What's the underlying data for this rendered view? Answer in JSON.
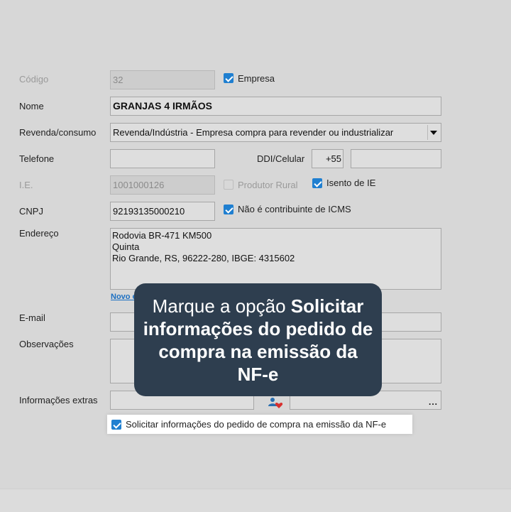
{
  "form": {
    "codigo": {
      "label": "Código",
      "value": "32"
    },
    "empresa": {
      "label": "Empresa",
      "checked": true
    },
    "nome": {
      "label": "Nome",
      "value": "GRANJAS 4 IRMÃOS"
    },
    "revenda": {
      "label": "Revenda/consumo",
      "value": "Revenda/Indústria - Empresa compra para revender ou industrializar"
    },
    "telefone": {
      "label": "Telefone",
      "value": ""
    },
    "celular": {
      "label": "DDI/Celular",
      "ddi": "+55",
      "value": ""
    },
    "ie": {
      "label": "I.E.",
      "value": "1001000126"
    },
    "produtor_rural": {
      "label": "Produtor Rural",
      "checked": false
    },
    "isento_ie": {
      "label": "Isento de IE",
      "checked": true
    },
    "cnpj": {
      "label": "CNPJ",
      "value": "92193135000210"
    },
    "nao_contribuinte": {
      "label": "Não é contribuinte de ICMS",
      "checked": true
    },
    "endereco": {
      "label": "Endereço",
      "lines": [
        "Rodovia BR-471 KM500",
        "Quinta",
        "Rio Grande, RS, 96222-280, IBGE: 4315602"
      ],
      "link_prefix": "Novo e"
    },
    "email": {
      "label": "E-mail",
      "value": ""
    },
    "observacoes": {
      "label": "Observações",
      "value": ""
    },
    "info_extras": {
      "label": "Informações extras",
      "value": "",
      "button": "..."
    },
    "solicitar": {
      "label": "Solicitar informações do pedido de compra na emissão da NF-e",
      "checked": true
    }
  },
  "tooltip": {
    "prefix": "Marque a opção ",
    "bold": "Solicitar informações do pedido de compra na emissão da NF-e"
  },
  "icons": {
    "checkbox": "check-icon",
    "dropdown": "chevron-down-icon",
    "extras": "people-heart-icon"
  },
  "colors": {
    "accent": "#1f7fd0",
    "tooltip_bg": "#2e3e4f",
    "link": "#1b6fc2"
  }
}
